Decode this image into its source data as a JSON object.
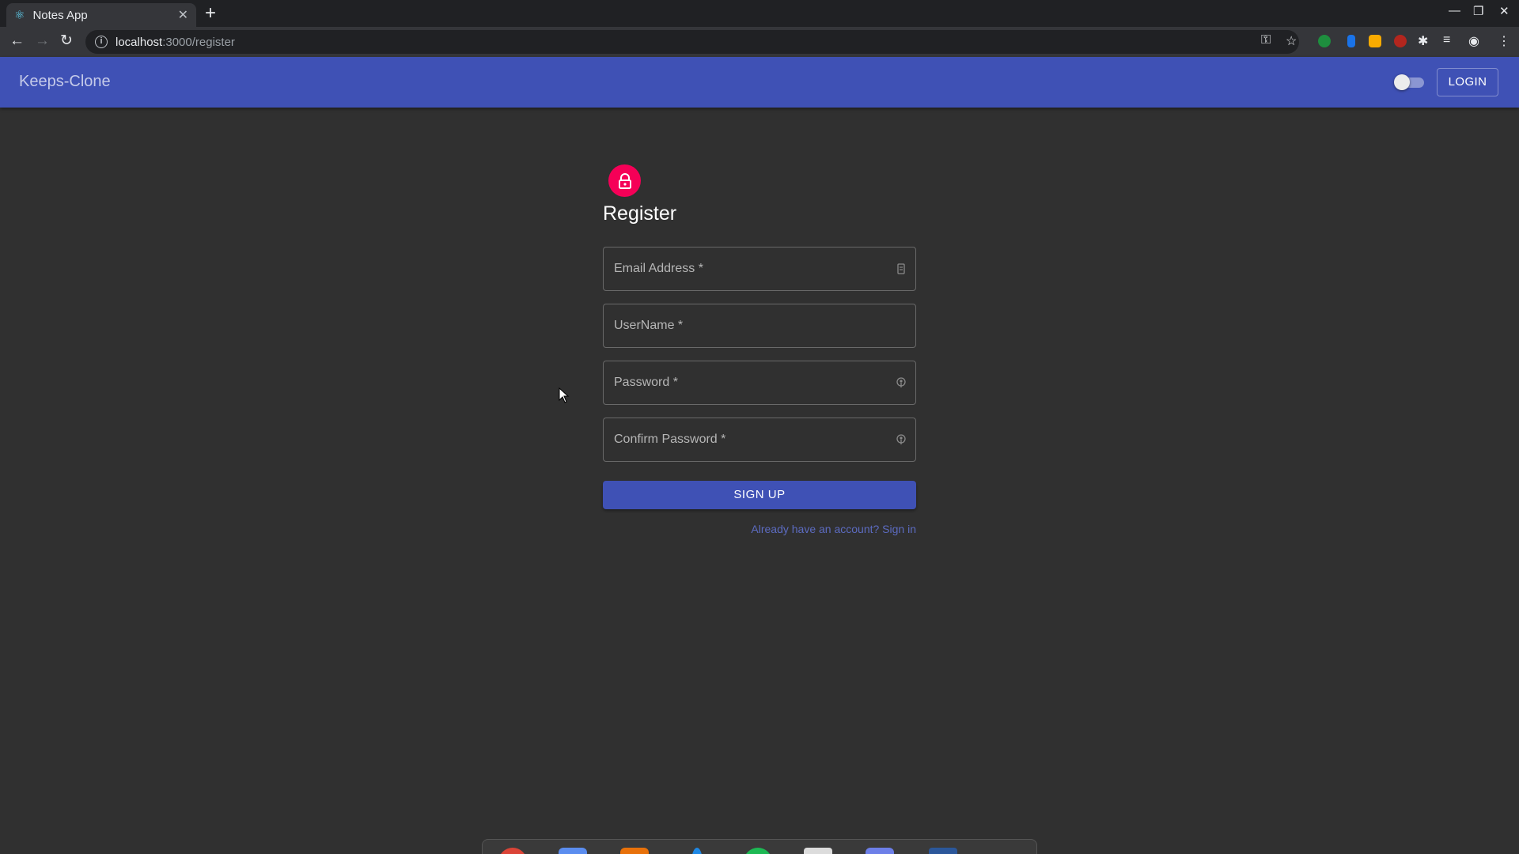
{
  "browser": {
    "tab_title": "Notes App",
    "tab_favicon": "react-icon",
    "tab_close": "✕",
    "new_tab": "+",
    "url_host": "localhost",
    "url_path": ":3000/register",
    "window_controls": [
      "minimize-icon",
      "restore-icon",
      "close-icon"
    ]
  },
  "appbar": {
    "brand": "Keeps-Clone",
    "theme_toggle": "off",
    "login_label": "LOGIN"
  },
  "form": {
    "icon": "lock-icon",
    "title": "Register",
    "email_placeholder": "Email Address *",
    "username_placeholder": "UserName *",
    "password_placeholder": "Password *",
    "confirm_placeholder": "Confirm Password *",
    "submit_label": "SIGN UP",
    "signin_link": "Already have an account? Sign in"
  },
  "colors": {
    "background": "#303030",
    "primary": "#3f51b5",
    "secondary": "#f50057"
  }
}
